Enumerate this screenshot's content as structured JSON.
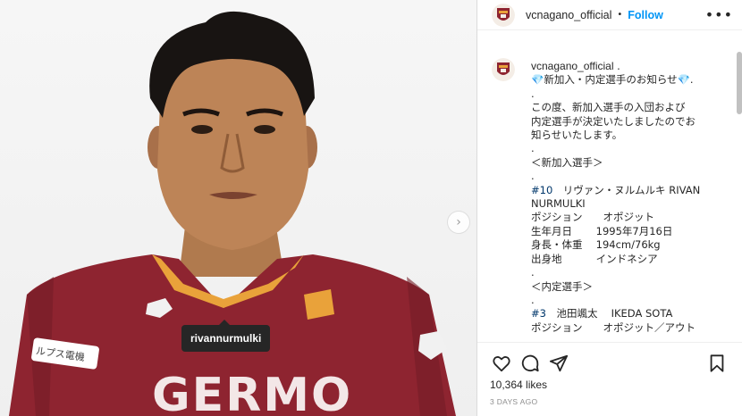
{
  "header": {
    "username": "vcnagano_official",
    "separator": "•",
    "follow_label": "Follow",
    "more_label": "•••"
  },
  "photo": {
    "tag_label": "rivannurmulki",
    "next_glyph": "›"
  },
  "caption": {
    "username": "vcnagano_official",
    "line1_tail": " .",
    "line2": "💎新加入・内定選手のお知らせ💎.",
    "line3": ".",
    "line4": "この度、新加入選手の入団および",
    "line5": "内定選手が決定いたしましたのでお",
    "line6": "知らせいたします。",
    "line7": ".",
    "line8": "＜新加入選手＞",
    "line9": ".",
    "line10_num": "#10",
    "line10_text": "　リヴァン・ヌルムルキ RIVAN",
    "line11": "NURMULKI",
    "line12": "ポジション　　オポジット",
    "line13": "生年月日　　 1995年7月16日",
    "line14": "身長・体重　 194cm/76kg",
    "line15": "出身地　　　 インドネシア",
    "line16": ".",
    "line17": "＜内定選手＞",
    "line18": ".",
    "line19_num": "#3",
    "line19_text": "　池田颯太　 IKEDA SOTA",
    "line20": "ポジション　　オポジット／アウト"
  },
  "footer": {
    "likes": "10,364 likes",
    "time_ago": "3 DAYS AGO"
  },
  "colors": {
    "jersey": "#8e2430",
    "accent_blue": "#0095f6",
    "link_blue": "#00376b"
  }
}
